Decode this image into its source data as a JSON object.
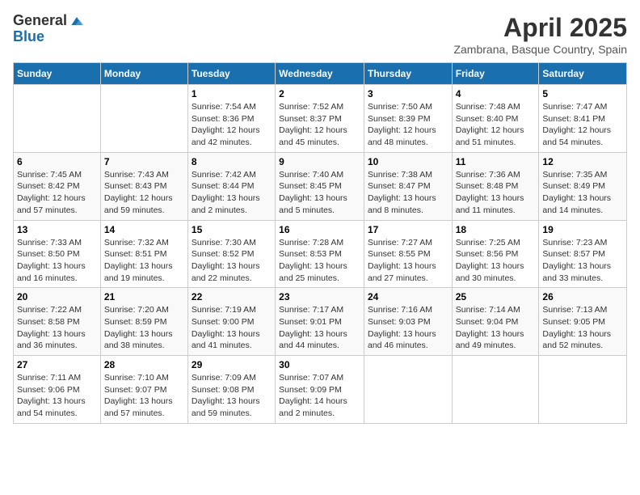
{
  "logo": {
    "general": "General",
    "blue": "Blue"
  },
  "title": "April 2025",
  "subtitle": "Zambrana, Basque Country, Spain",
  "days_of_week": [
    "Sunday",
    "Monday",
    "Tuesday",
    "Wednesday",
    "Thursday",
    "Friday",
    "Saturday"
  ],
  "weeks": [
    [
      {
        "day": "",
        "sunrise": "",
        "sunset": "",
        "daylight": ""
      },
      {
        "day": "",
        "sunrise": "",
        "sunset": "",
        "daylight": ""
      },
      {
        "day": "1",
        "sunrise": "Sunrise: 7:54 AM",
        "sunset": "Sunset: 8:36 PM",
        "daylight": "Daylight: 12 hours and 42 minutes."
      },
      {
        "day": "2",
        "sunrise": "Sunrise: 7:52 AM",
        "sunset": "Sunset: 8:37 PM",
        "daylight": "Daylight: 12 hours and 45 minutes."
      },
      {
        "day": "3",
        "sunrise": "Sunrise: 7:50 AM",
        "sunset": "Sunset: 8:39 PM",
        "daylight": "Daylight: 12 hours and 48 minutes."
      },
      {
        "day": "4",
        "sunrise": "Sunrise: 7:48 AM",
        "sunset": "Sunset: 8:40 PM",
        "daylight": "Daylight: 12 hours and 51 minutes."
      },
      {
        "day": "5",
        "sunrise": "Sunrise: 7:47 AM",
        "sunset": "Sunset: 8:41 PM",
        "daylight": "Daylight: 12 hours and 54 minutes."
      }
    ],
    [
      {
        "day": "6",
        "sunrise": "Sunrise: 7:45 AM",
        "sunset": "Sunset: 8:42 PM",
        "daylight": "Daylight: 12 hours and 57 minutes."
      },
      {
        "day": "7",
        "sunrise": "Sunrise: 7:43 AM",
        "sunset": "Sunset: 8:43 PM",
        "daylight": "Daylight: 12 hours and 59 minutes."
      },
      {
        "day": "8",
        "sunrise": "Sunrise: 7:42 AM",
        "sunset": "Sunset: 8:44 PM",
        "daylight": "Daylight: 13 hours and 2 minutes."
      },
      {
        "day": "9",
        "sunrise": "Sunrise: 7:40 AM",
        "sunset": "Sunset: 8:45 PM",
        "daylight": "Daylight: 13 hours and 5 minutes."
      },
      {
        "day": "10",
        "sunrise": "Sunrise: 7:38 AM",
        "sunset": "Sunset: 8:47 PM",
        "daylight": "Daylight: 13 hours and 8 minutes."
      },
      {
        "day": "11",
        "sunrise": "Sunrise: 7:36 AM",
        "sunset": "Sunset: 8:48 PM",
        "daylight": "Daylight: 13 hours and 11 minutes."
      },
      {
        "day": "12",
        "sunrise": "Sunrise: 7:35 AM",
        "sunset": "Sunset: 8:49 PM",
        "daylight": "Daylight: 13 hours and 14 minutes."
      }
    ],
    [
      {
        "day": "13",
        "sunrise": "Sunrise: 7:33 AM",
        "sunset": "Sunset: 8:50 PM",
        "daylight": "Daylight: 13 hours and 16 minutes."
      },
      {
        "day": "14",
        "sunrise": "Sunrise: 7:32 AM",
        "sunset": "Sunset: 8:51 PM",
        "daylight": "Daylight: 13 hours and 19 minutes."
      },
      {
        "day": "15",
        "sunrise": "Sunrise: 7:30 AM",
        "sunset": "Sunset: 8:52 PM",
        "daylight": "Daylight: 13 hours and 22 minutes."
      },
      {
        "day": "16",
        "sunrise": "Sunrise: 7:28 AM",
        "sunset": "Sunset: 8:53 PM",
        "daylight": "Daylight: 13 hours and 25 minutes."
      },
      {
        "day": "17",
        "sunrise": "Sunrise: 7:27 AM",
        "sunset": "Sunset: 8:55 PM",
        "daylight": "Daylight: 13 hours and 27 minutes."
      },
      {
        "day": "18",
        "sunrise": "Sunrise: 7:25 AM",
        "sunset": "Sunset: 8:56 PM",
        "daylight": "Daylight: 13 hours and 30 minutes."
      },
      {
        "day": "19",
        "sunrise": "Sunrise: 7:23 AM",
        "sunset": "Sunset: 8:57 PM",
        "daylight": "Daylight: 13 hours and 33 minutes."
      }
    ],
    [
      {
        "day": "20",
        "sunrise": "Sunrise: 7:22 AM",
        "sunset": "Sunset: 8:58 PM",
        "daylight": "Daylight: 13 hours and 36 minutes."
      },
      {
        "day": "21",
        "sunrise": "Sunrise: 7:20 AM",
        "sunset": "Sunset: 8:59 PM",
        "daylight": "Daylight: 13 hours and 38 minutes."
      },
      {
        "day": "22",
        "sunrise": "Sunrise: 7:19 AM",
        "sunset": "Sunset: 9:00 PM",
        "daylight": "Daylight: 13 hours and 41 minutes."
      },
      {
        "day": "23",
        "sunrise": "Sunrise: 7:17 AM",
        "sunset": "Sunset: 9:01 PM",
        "daylight": "Daylight: 13 hours and 44 minutes."
      },
      {
        "day": "24",
        "sunrise": "Sunrise: 7:16 AM",
        "sunset": "Sunset: 9:03 PM",
        "daylight": "Daylight: 13 hours and 46 minutes."
      },
      {
        "day": "25",
        "sunrise": "Sunrise: 7:14 AM",
        "sunset": "Sunset: 9:04 PM",
        "daylight": "Daylight: 13 hours and 49 minutes."
      },
      {
        "day": "26",
        "sunrise": "Sunrise: 7:13 AM",
        "sunset": "Sunset: 9:05 PM",
        "daylight": "Daylight: 13 hours and 52 minutes."
      }
    ],
    [
      {
        "day": "27",
        "sunrise": "Sunrise: 7:11 AM",
        "sunset": "Sunset: 9:06 PM",
        "daylight": "Daylight: 13 hours and 54 minutes."
      },
      {
        "day": "28",
        "sunrise": "Sunrise: 7:10 AM",
        "sunset": "Sunset: 9:07 PM",
        "daylight": "Daylight: 13 hours and 57 minutes."
      },
      {
        "day": "29",
        "sunrise": "Sunrise: 7:09 AM",
        "sunset": "Sunset: 9:08 PM",
        "daylight": "Daylight: 13 hours and 59 minutes."
      },
      {
        "day": "30",
        "sunrise": "Sunrise: 7:07 AM",
        "sunset": "Sunset: 9:09 PM",
        "daylight": "Daylight: 14 hours and 2 minutes."
      },
      {
        "day": "",
        "sunrise": "",
        "sunset": "",
        "daylight": ""
      },
      {
        "day": "",
        "sunrise": "",
        "sunset": "",
        "daylight": ""
      },
      {
        "day": "",
        "sunrise": "",
        "sunset": "",
        "daylight": ""
      }
    ]
  ]
}
